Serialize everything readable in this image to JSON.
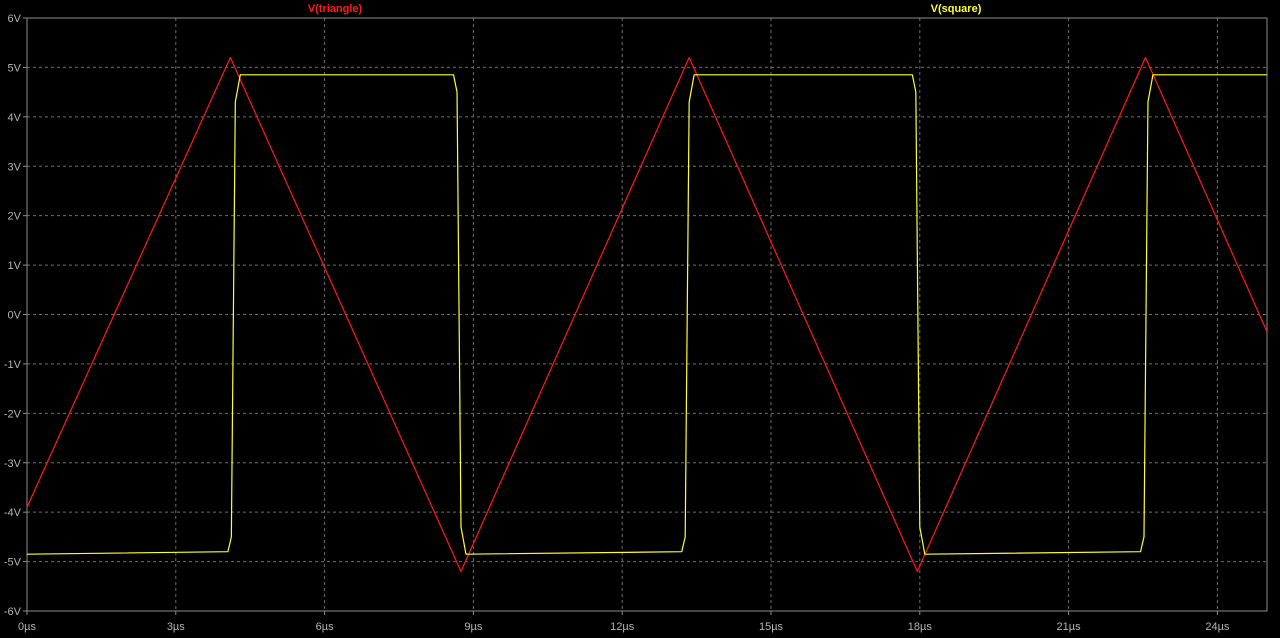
{
  "chart_data": {
    "type": "line",
    "title": "",
    "xlabel": "",
    "ylabel": "",
    "xlim": [
      0,
      25
    ],
    "ylim": [
      -6,
      6
    ],
    "grid": true,
    "legend": "top",
    "x_unit": "µs",
    "y_unit": "V",
    "x_ticks": [
      0,
      3,
      6,
      9,
      12,
      15,
      18,
      21,
      24
    ],
    "x_tick_labels": [
      "0µs",
      "3µs",
      "6µs",
      "9µs",
      "12µs",
      "15µs",
      "18µs",
      "21µs",
      "24µs"
    ],
    "y_ticks": [
      6,
      5,
      4,
      3,
      2,
      1,
      0,
      -1,
      -2,
      -3,
      -4,
      -5,
      -6
    ],
    "y_tick_labels": [
      "6V",
      "5V",
      "4V",
      "3V",
      "2V",
      "1V",
      "0V",
      "-1V",
      "-2V",
      "-3V",
      "-4V",
      "-5V",
      "-6V"
    ],
    "colors": {
      "background": "#000000",
      "axis": "#8c8c8c",
      "grid": "#6e6e6e",
      "tick_label": "#b4b4b4"
    },
    "series": [
      {
        "name": "V(triangle)",
        "color": "#ff1a1a",
        "points": [
          [
            0.0,
            -3.9
          ],
          [
            4.1,
            5.2
          ],
          [
            8.75,
            -5.2
          ],
          [
            13.35,
            5.2
          ],
          [
            17.95,
            -5.2
          ],
          [
            22.55,
            5.2
          ],
          [
            25.0,
            -0.35
          ]
        ]
      },
      {
        "name": "V(square)",
        "color": "#ffff33",
        "points": [
          [
            0.0,
            -4.85
          ],
          [
            4.05,
            -4.8
          ],
          [
            4.12,
            -4.5
          ],
          [
            4.2,
            4.3
          ],
          [
            4.3,
            4.85
          ],
          [
            8.6,
            4.85
          ],
          [
            8.67,
            4.5
          ],
          [
            8.75,
            -4.3
          ],
          [
            8.85,
            -4.85
          ],
          [
            13.2,
            -4.8
          ],
          [
            13.27,
            -4.5
          ],
          [
            13.35,
            4.3
          ],
          [
            13.45,
            4.85
          ],
          [
            17.85,
            4.85
          ],
          [
            17.92,
            4.5
          ],
          [
            18.0,
            -4.3
          ],
          [
            18.1,
            -4.85
          ],
          [
            22.45,
            -4.8
          ],
          [
            22.52,
            -4.5
          ],
          [
            22.6,
            4.3
          ],
          [
            22.7,
            4.85
          ],
          [
            25.0,
            4.85
          ]
        ]
      }
    ]
  }
}
